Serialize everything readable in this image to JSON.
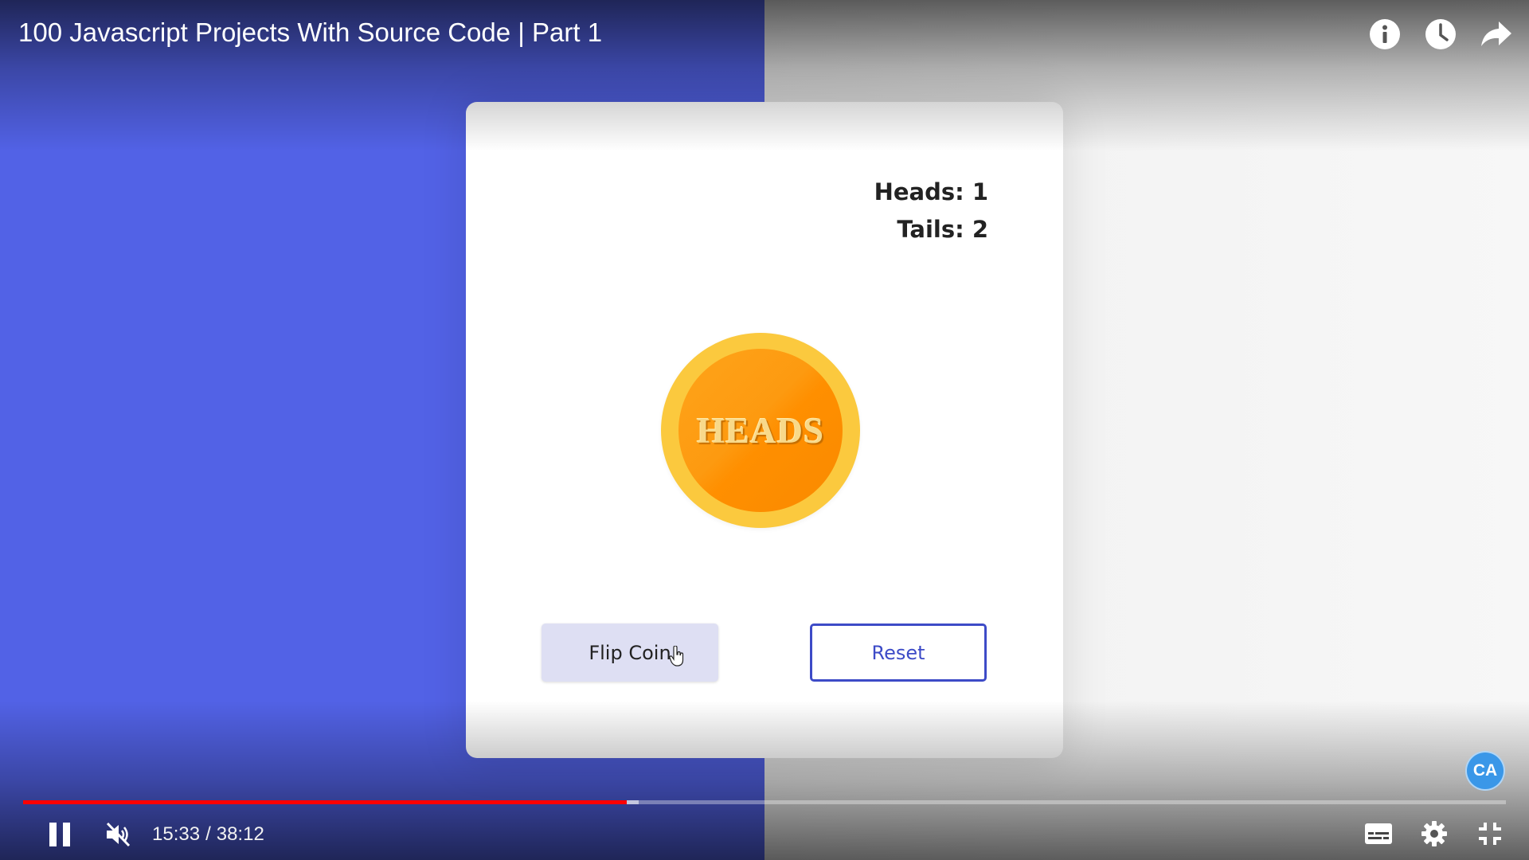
{
  "video": {
    "title": "100 Javascript Projects With Source Code | Part 1"
  },
  "top_controls": {
    "icons": [
      "info-icon",
      "clock-icon",
      "share-icon"
    ]
  },
  "app": {
    "scores": {
      "heads_label": "Heads",
      "heads_value": "1",
      "tails_label": "Tails",
      "tails_value": "2"
    },
    "coin_text": "HEADS",
    "flip_button": "Flip Coin",
    "reset_button": "Reset"
  },
  "badge": {
    "text": "CA"
  },
  "player": {
    "current_time": "15:33",
    "separator": "/",
    "duration": "38:12",
    "played_fraction": 0.407,
    "buffered_fraction": 0.415,
    "muted": true,
    "playing": true,
    "bottom_icons": [
      "subtitles-icon",
      "settings-gear-icon",
      "exit-fullscreen-icon"
    ]
  },
  "colors": {
    "left_background": "#5262e6",
    "right_background": "#f3f3f3",
    "progress_played": "#ff0000",
    "reset_accent": "#3d4bc7",
    "coin_outer": "#fbc93e",
    "coin_inner": "#ff9a0e",
    "badge": "#3a97e8"
  }
}
